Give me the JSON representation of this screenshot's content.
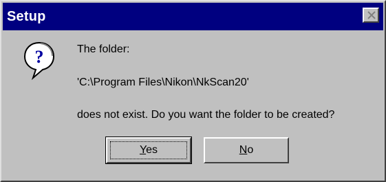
{
  "window": {
    "title": "Setup",
    "close_icon": "close-icon"
  },
  "message": {
    "icon": "question-icon",
    "line1": "The folder:",
    "line2": "'C:\\Program Files\\Nikon\\NkScan20'",
    "line3": "does not exist.  Do you want the folder to be created?"
  },
  "buttons": {
    "yes": {
      "mnemonic": "Y",
      "rest": "es"
    },
    "no": {
      "mnemonic": "N",
      "rest": "o"
    }
  },
  "colors": {
    "titlebar": "#000080",
    "face": "#c0c0c0"
  }
}
